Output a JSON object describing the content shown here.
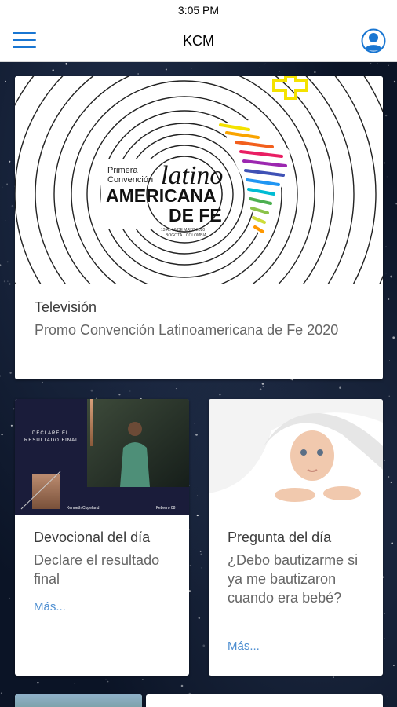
{
  "status": {
    "time": "3:05 PM"
  },
  "nav": {
    "title": "KCM"
  },
  "feature": {
    "category": "Televisión",
    "title": "Promo Convención Latinoamericana de Fe 2020",
    "banner": {
      "line1": "Primera",
      "line2": "Convención",
      "script": "latino",
      "big1": "AMERICANA",
      "big2": "DE FE",
      "date": "13 AL 16 DE MAYO 2020",
      "place": "BOGOTÁ · COLOMBIA"
    }
  },
  "cards": [
    {
      "category": "Devocional del día",
      "title": "Declare el resultado final",
      "more": "Más...",
      "thumb": {
        "headline_1": "DECLARE EL",
        "headline_2": "RESULTADO FINAL",
        "author": "Kenneth Copeland",
        "date": "Febrero 08"
      }
    },
    {
      "category": "Pregunta del día",
      "title": "¿Debo bautizarme si ya me bautizaron cuando era bebé?",
      "more": "Más..."
    }
  ],
  "colors": {
    "accent": "#1976d2",
    "link": "#4f8fd1",
    "background": "#0b1426"
  }
}
